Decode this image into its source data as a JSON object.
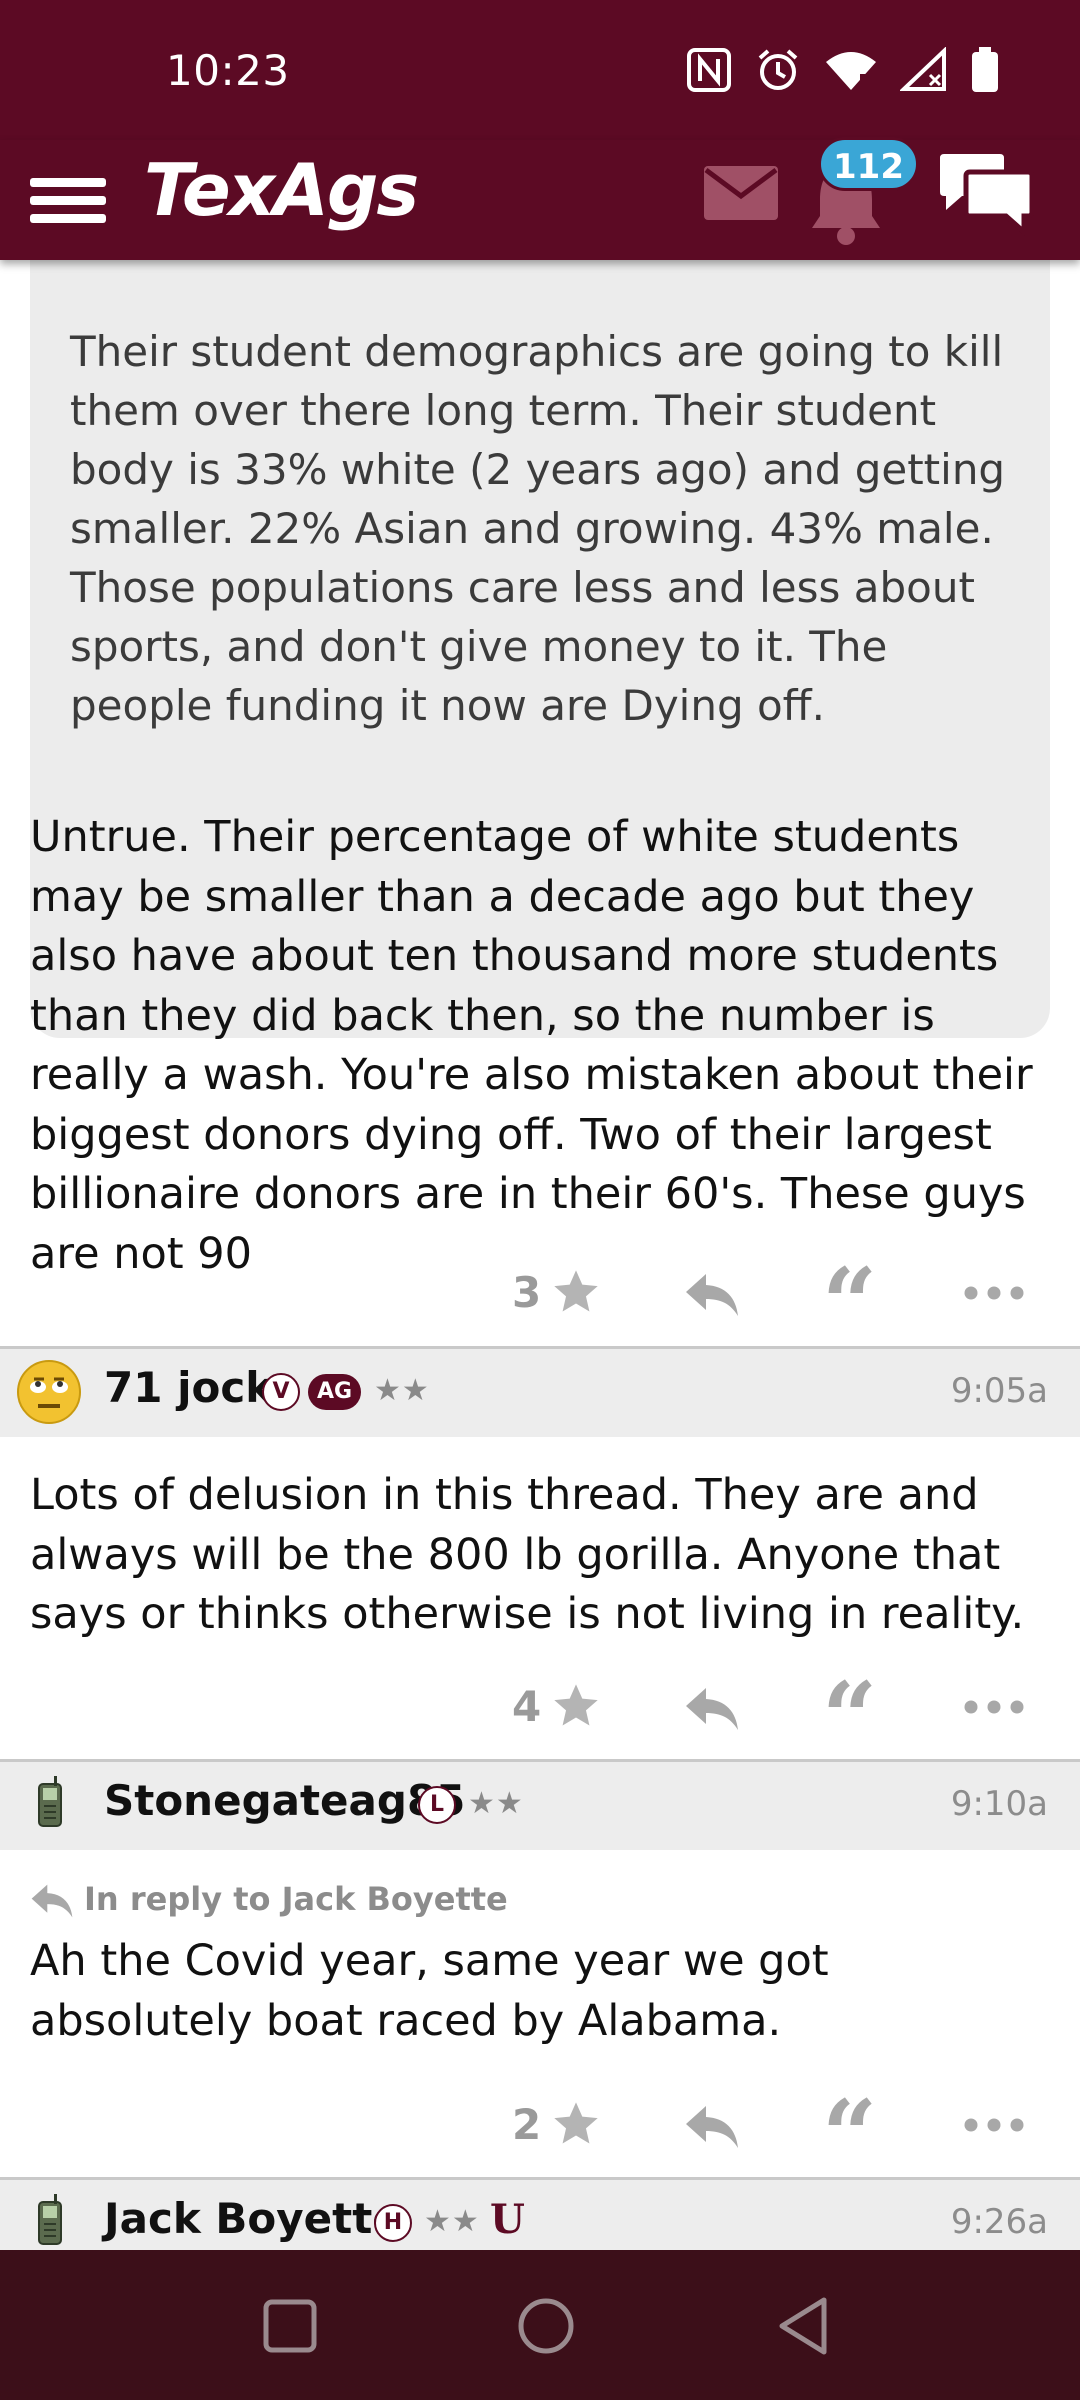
{
  "status_bar": {
    "time": "10:23",
    "icons": [
      "nfc-icon",
      "alarm-icon",
      "wifi-icon",
      "signal-icon",
      "battery-icon"
    ]
  },
  "header": {
    "logo": "TexAgs",
    "notification_count": "112",
    "icons": [
      "menu-icon",
      "mail-icon",
      "bell-icon",
      "chat-icon"
    ],
    "background_color": "#5c0a24"
  },
  "quoted_post": {
    "text": "Their student demographics are going to kill them over there long term. Their student body is 33% white (2 years ago) and getting smaller. 22% Asian and growing. 43% male. Those populations care less and less about sports, and don't give money to it. The people funding it now are Dying off."
  },
  "posts": [
    {
      "text": "Untrue. Their percentage of white students may be smaller than a decade ago but they also have about ten thousand more students than they did back then, so the number is really a wash. You're also mistaken about their biggest donors dying off. Two of their largest billionaire donors are in their 60's. These guys are not 90",
      "star_count": "3"
    },
    {
      "author": "71 jock",
      "badges": [
        "V",
        "AG"
      ],
      "stars": "★★",
      "time": "9:05a",
      "text": "Lots of delusion in this thread. They are and always will be the 800 lb gorilla. Anyone that says or thinks otherwise is not living in reality.",
      "star_count": "4"
    },
    {
      "author": "Stonegateag85",
      "badges": [
        "L"
      ],
      "stars": "★★",
      "time": "9:10a",
      "reply_to": "In reply to Jack Boyette",
      "text": "Ah the Covid year, same year we got absolutely boat raced by Alabama.",
      "star_count": "2"
    },
    {
      "author": "Jack Boyette",
      "badges": [
        "H"
      ],
      "stars": "★★",
      "extra_badge": "U",
      "time": "9:26a"
    }
  ],
  "nav": {
    "icons": [
      "recents-icon",
      "home-icon",
      "back-icon"
    ]
  }
}
